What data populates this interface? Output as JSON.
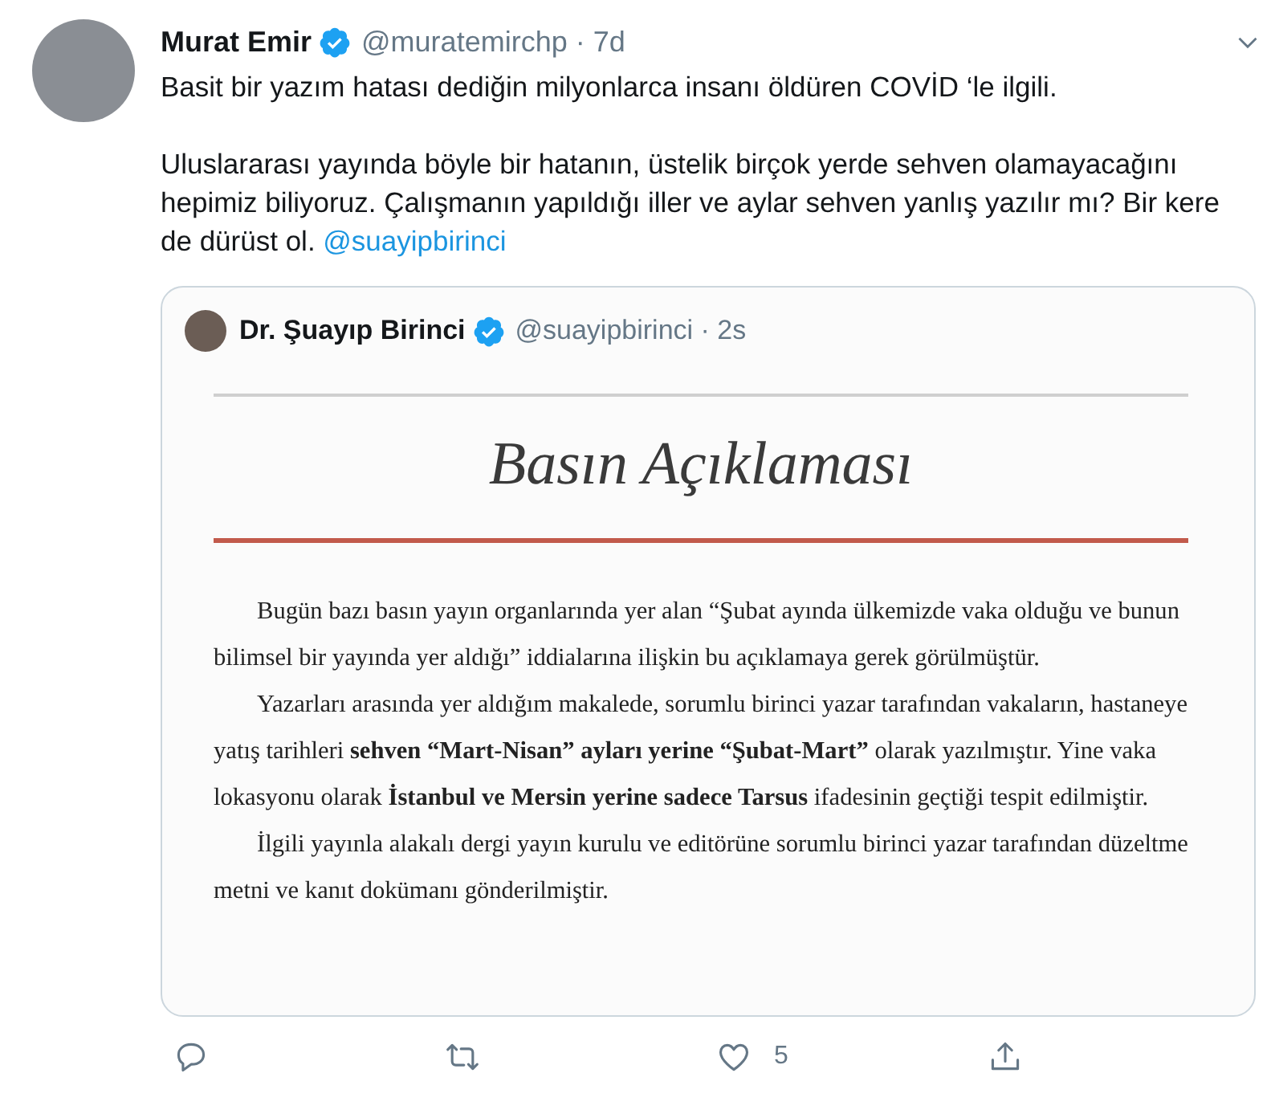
{
  "tweet": {
    "author": {
      "name": "Murat Emir",
      "verified": true,
      "meta": "@muratemirchp · 7d"
    },
    "paragraphs": [
      {
        "text": "Basit bir yazım hatası dediğin milyonlarca insanı öldüren COVİD ‘le ilgili."
      },
      {
        "text": "Uluslararası yayında böyle bir hatanın, üstelik birçok yerde sehven olamayacağını hepimiz biliyoruz. Çalışmanın yapıldığı iller ve aylar sehven yanlış yazılır mı? Bir kere de dürüst ol.",
        "link": "@suayipbirinci"
      }
    ],
    "quote": {
      "author": {
        "name": "Dr. Şuayıp Birinci",
        "verified": true,
        "meta": "@suayipbirinci · 2s"
      },
      "document": {
        "title": "Basın Açıklaması",
        "paragraphs": [
          "Bugün bazı basın yayın organlarında yer alan “Şubat ayında ülkemizde vaka olduğu ve bunun bilimsel bir yayında yer aldığı” iddialarına ilişkin bu açıklamaya gerek görülmüştür.",
          "Yazarları arasında yer aldığım makalede, sorumlu birinci yazar tarafından vakaların, hastaneye yatış tarihleri **sehven “Mart-Nisan” ayları yerine “Şubat-Mart”** olarak yazılmıştır. Yine vaka lokasyonu olarak **İstanbul ve Mersin yerine sadece Tarsus** ifadesinin geçtiği tespit edilmiştir.",
          "İlgili yayınla alakalı dergi yayın kurulu ve editörüne sorumlu birinci yazar tarafından düzeltme metni ve kanıt dokümanı gönderilmiştir."
        ]
      }
    },
    "actions": [
      {
        "kind": "reply"
      },
      {
        "kind": "retweet"
      },
      {
        "kind": "like",
        "count": "5"
      },
      {
        "kind": "share"
      }
    ]
  }
}
